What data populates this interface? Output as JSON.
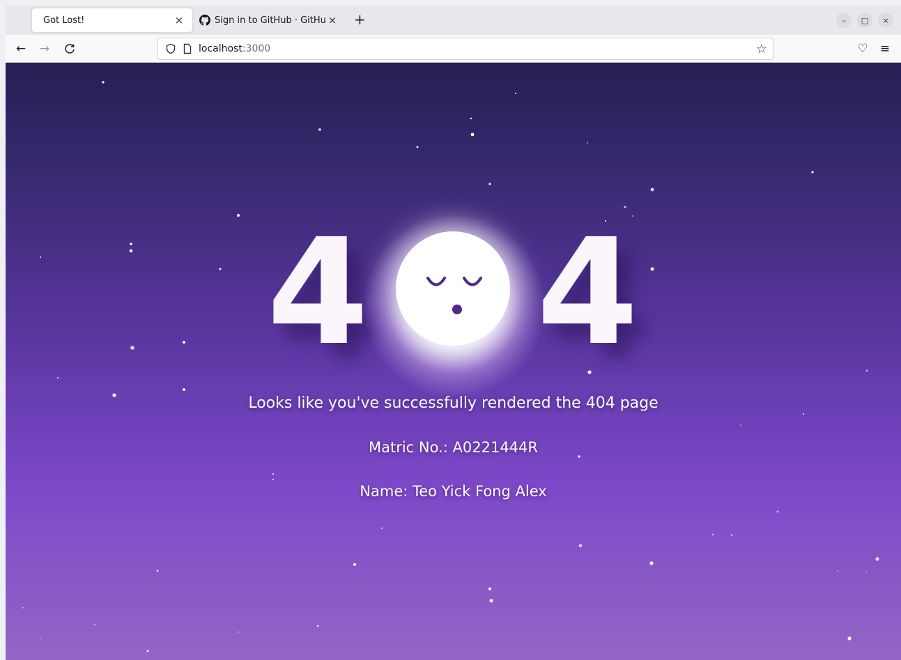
{
  "browser": {
    "tabs": [
      {
        "title": "Got Lost!",
        "active": true
      },
      {
        "title": "Sign in to GitHub · GitHub",
        "active": false
      }
    ],
    "tab_close_glyph": "×",
    "new_tab_glyph": "+",
    "window_controls": {
      "minimize": "–",
      "maximize": "□",
      "close": "×"
    },
    "nav": {
      "back": "←",
      "forward": "→",
      "reload": "C"
    },
    "address": {
      "host": "localhost",
      "port": ":3000"
    },
    "bookmark_glyph": "☆",
    "pocket_glyph": "♡",
    "menu_glyph": "≡"
  },
  "page": {
    "digits": {
      "left": "4",
      "right": "4"
    },
    "message": "Looks like you've successfully rendered the 404 page",
    "matric": "Matric No.: A0221444R",
    "name": "Name: Teo Yick Fong Alex"
  },
  "colors": {
    "gradient_top": "#261f54",
    "gradient_bottom": "#9366c6",
    "moon_face": "#4f2a8a",
    "text": "#ffffff"
  }
}
